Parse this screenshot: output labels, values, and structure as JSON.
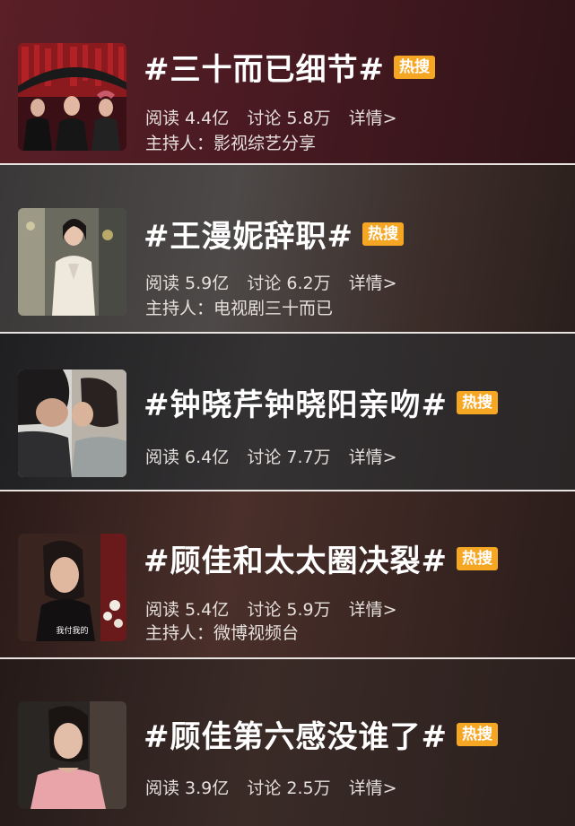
{
  "topics": [
    {
      "title": "#三十而已细节#",
      "badge": "热搜",
      "read": "阅读 4.4亿",
      "discuss": "讨论 5.8万",
      "detail": "详情>",
      "host": "主持人：影视综艺分享"
    },
    {
      "title": "#王漫妮辞职#",
      "badge": "热搜",
      "read": "阅读 5.9亿",
      "discuss": "讨论 6.2万",
      "detail": "详情>",
      "host": "主持人：电视剧三十而已"
    },
    {
      "title": "#钟晓芹钟晓阳亲吻#",
      "badge": "热搜",
      "read": "阅读 6.4亿",
      "discuss": "讨论 7.7万",
      "detail": "详情>"
    },
    {
      "title": "#顾佳和太太圈决裂#",
      "badge": "热搜",
      "read": "阅读 5.4亿",
      "discuss": "讨论 5.9万",
      "detail": "详情>",
      "host": "主持人：微博视频台",
      "thumb_caption": "我付我的"
    },
    {
      "title": "#顾佳第六感没谁了#",
      "badge": "热搜",
      "read": "阅读 3.9亿",
      "discuss": "讨论 2.5万",
      "detail": "详情>"
    }
  ],
  "colors": {
    "badge": "#f5a623",
    "title": "#ffffff",
    "meta": "#e6e0dc"
  }
}
